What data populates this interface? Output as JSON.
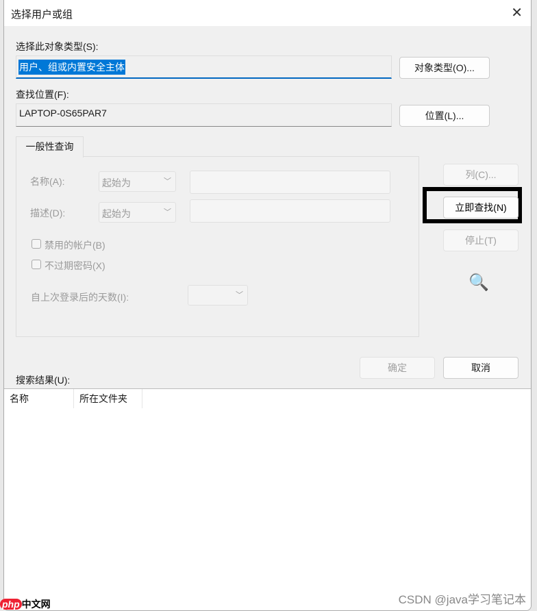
{
  "title": "选择用户或组",
  "object_type": {
    "label": "选择此对象类型(S):",
    "value": "用户、组或内置安全主体",
    "button": "对象类型(O)..."
  },
  "location": {
    "label": "查找位置(F):",
    "value": "LAPTOP-0S65PAR7",
    "button": "位置(L)..."
  },
  "tab": "一般性查询",
  "query": {
    "name_label": "名称(A):",
    "name_mode": "起始为",
    "desc_label": "描述(D):",
    "desc_mode": "起始为",
    "disabled_accounts": "禁用的帐户(B)",
    "no_expire_pwd": "不过期密码(X)",
    "days_label": "自上次登录后的天数(I):"
  },
  "buttons": {
    "columns": "列(C)...",
    "find_now": "立即查找(N)",
    "stop": "停止(T)",
    "ok": "确定",
    "cancel": "取消"
  },
  "results": {
    "label": "搜索结果(U):",
    "columns": [
      "名称",
      "所在文件夹"
    ]
  },
  "watermark": "CSDN @java学习笔记本",
  "logo": "php中文网"
}
